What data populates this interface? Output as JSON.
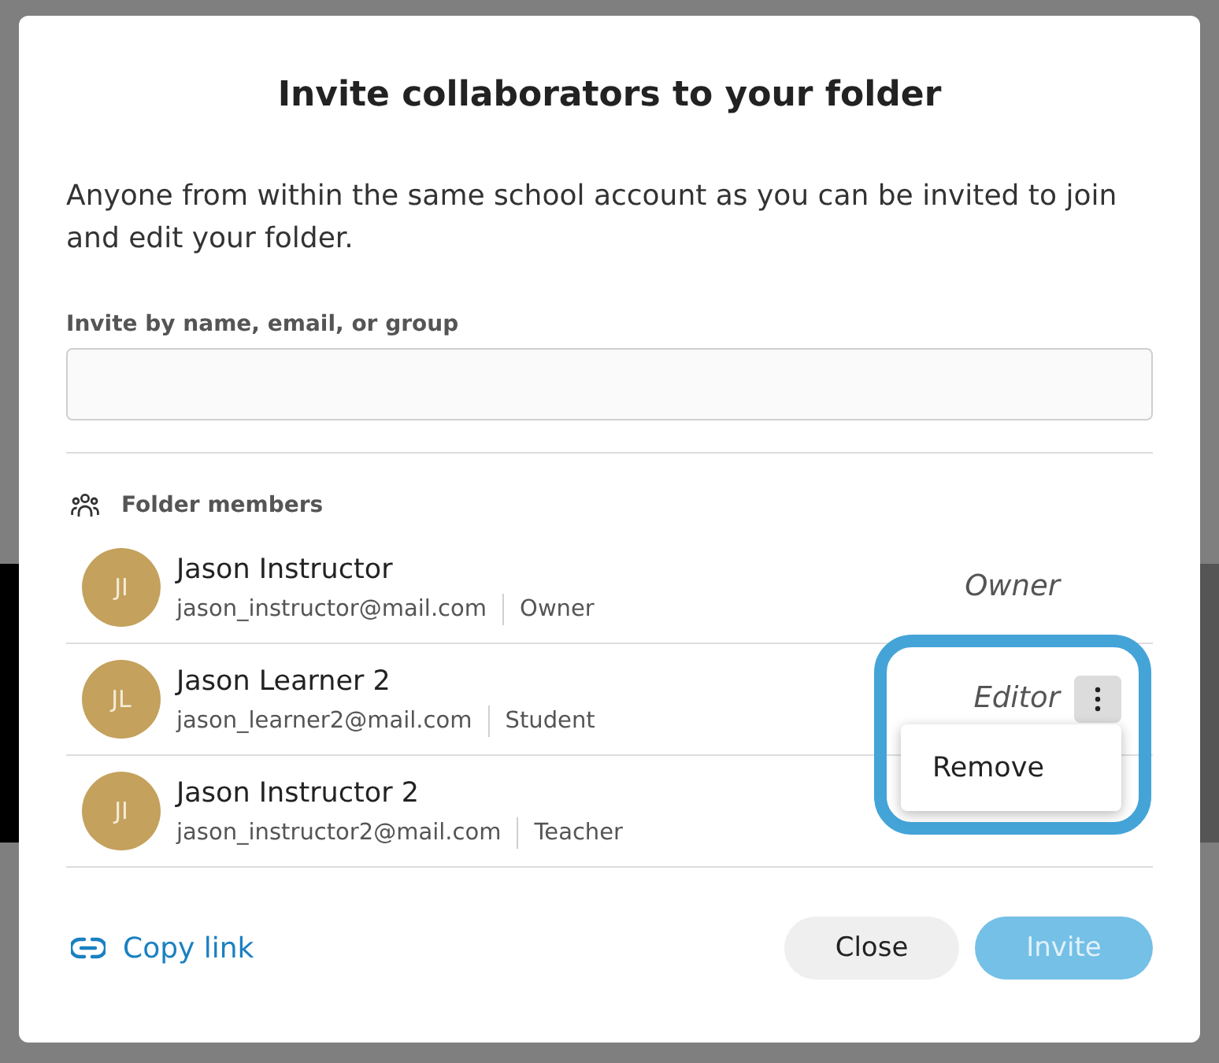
{
  "dialog": {
    "title": "Invite collaborators to your folder",
    "description": "Anyone from within the same school account as you can be invited to join and edit your folder.",
    "invite_field": {
      "label": "Invite by name, email, or group"
    }
  },
  "members_section": {
    "heading": "Folder members"
  },
  "members": [
    {
      "initials": "JI",
      "name": "Jason Instructor",
      "email": "jason_instructor@mail.com",
      "role": "Owner",
      "access": "Owner",
      "menu_button": false
    },
    {
      "initials": "JL",
      "name": "Jason Learner 2",
      "email": "jason_learner2@mail.com",
      "role": "Student",
      "access": "Editor",
      "menu_button": true,
      "menu": {
        "open": true,
        "highlighted": true,
        "items": [
          "Remove"
        ]
      }
    },
    {
      "initials": "JI",
      "name": "Jason Instructor 2",
      "email": "jason_instructor2@mail.com",
      "role": "Teacher",
      "menu_button": false
    }
  ],
  "footer": {
    "copy_link": "Copy link",
    "buttons": [
      {
        "label": "Close",
        "kind": "secondary",
        "disabled": false
      },
      {
        "label": "Invite",
        "kind": "primary",
        "disabled": true
      }
    ]
  }
}
